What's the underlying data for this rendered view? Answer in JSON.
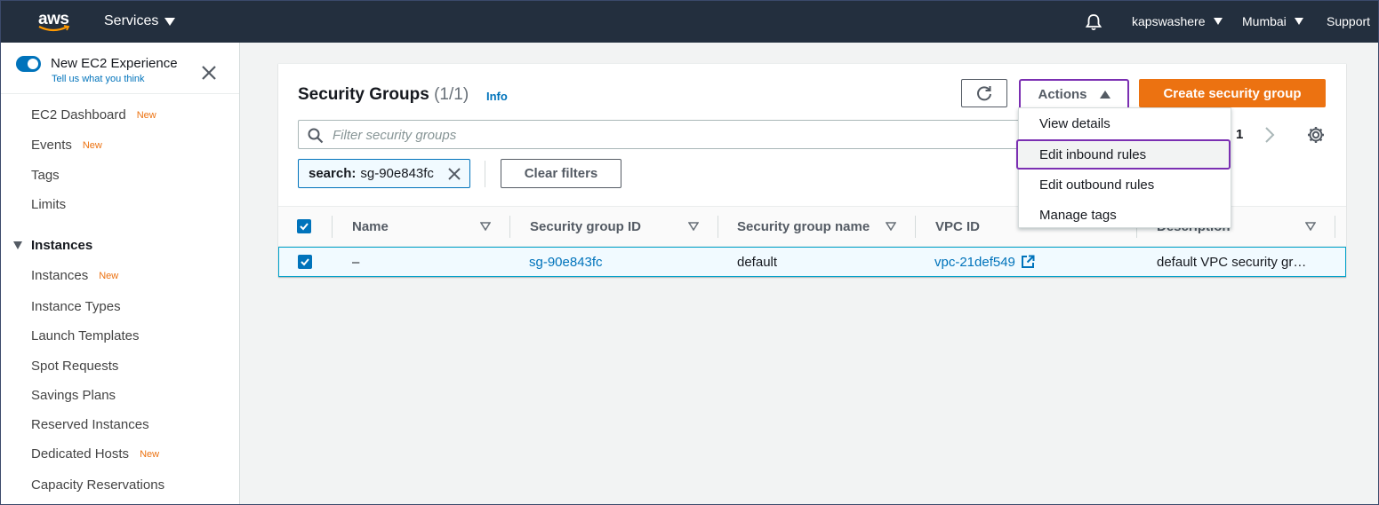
{
  "topnav": {
    "logo_text": "aws",
    "services_label": "Services",
    "username": "kapswashere",
    "region": "Mumbai",
    "support": "Support"
  },
  "sidebar": {
    "experience_title": "New EC2 Experience",
    "experience_link": "Tell us what you think",
    "new_badge": "New",
    "items_top": [
      {
        "label": "EC2 Dashboard",
        "is_new": true
      },
      {
        "label": "Events",
        "is_new": true
      },
      {
        "label": "Tags",
        "is_new": false
      },
      {
        "label": "Limits",
        "is_new": false
      }
    ],
    "section_instances": "Instances",
    "items_instances": [
      {
        "label": "Instances",
        "is_new": true
      },
      {
        "label": "Instance Types",
        "is_new": false
      },
      {
        "label": "Launch Templates",
        "is_new": false
      },
      {
        "label": "Spot Requests",
        "is_new": false
      },
      {
        "label": "Savings Plans",
        "is_new": false
      },
      {
        "label": "Reserved Instances",
        "is_new": false
      },
      {
        "label": "Dedicated Hosts",
        "is_new": true
      },
      {
        "label": "Capacity Reservations",
        "is_new": false
      }
    ]
  },
  "panel": {
    "title": "Security Groups",
    "count": "(1/1)",
    "info": "Info",
    "actions_label": "Actions",
    "create_label": "Create security group",
    "search_placeholder": "Filter security groups",
    "page_number": "1",
    "token_key": "search:",
    "token_value": "sg-90e843fc",
    "clear_filters": "Clear filters"
  },
  "table": {
    "columns": [
      "Name",
      "Security group ID",
      "Security group name",
      "VPC ID",
      "Description"
    ],
    "rows": [
      {
        "name": "–",
        "group_id": "sg-90e843fc",
        "group_name": "default",
        "vpc_id": "vpc-21def549",
        "description": "default VPC security gr…"
      }
    ]
  },
  "actions_menu": {
    "items": [
      "View details",
      "Edit inbound rules",
      "Edit outbound rules",
      "Manage tags"
    ],
    "highlighted": "Edit inbound rules"
  },
  "colors": {
    "nav_bg": "#232f3e",
    "accent_blue": "#0073bb",
    "create_orange": "#ec7211",
    "highlight_purple": "#7b2fb2"
  }
}
